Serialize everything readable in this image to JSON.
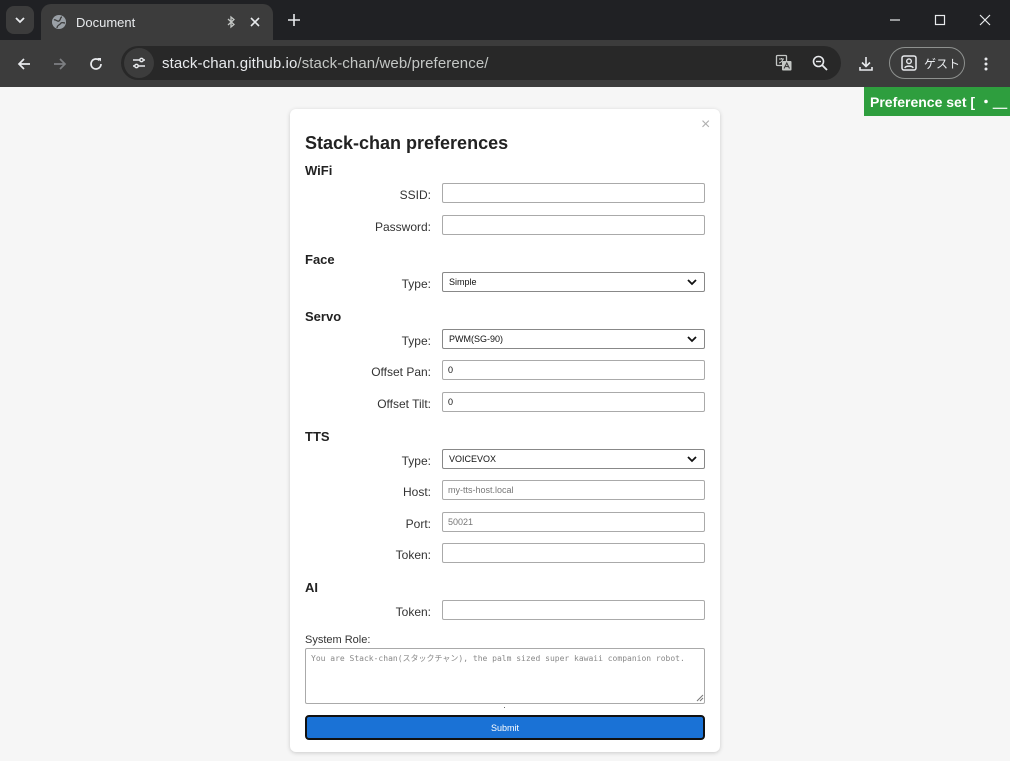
{
  "browser": {
    "tab_title": "Document",
    "url_host": "stack-chan.github.io",
    "url_path": "/stack-chan/web/preference/",
    "profile_label": "ゲスト"
  },
  "toast": {
    "text": "Preference set [ ・＿・]"
  },
  "form": {
    "title": "Stack-chan preferences",
    "wifi": {
      "heading": "WiFi",
      "ssid_label": "SSID:",
      "ssid_value": "",
      "password_label": "Password:",
      "password_value": ""
    },
    "face": {
      "heading": "Face",
      "type_label": "Type:",
      "type_value": "Simple"
    },
    "servo": {
      "heading": "Servo",
      "type_label": "Type:",
      "type_value": "PWM(SG-90)",
      "offset_pan_label": "Offset Pan:",
      "offset_pan_value": "0",
      "offset_tilt_label": "Offset Tilt:",
      "offset_tilt_value": "0"
    },
    "tts": {
      "heading": "TTS",
      "type_label": "Type:",
      "type_value": "VOICEVOX",
      "host_label": "Host:",
      "host_placeholder": "my-tts-host.local",
      "port_label": "Port:",
      "port_placeholder": "50021",
      "token_label": "Token:",
      "token_value": ""
    },
    "ai": {
      "heading": "AI",
      "token_label": "Token:",
      "token_value": ""
    },
    "system_role": {
      "label": "System Role:",
      "placeholder": "You are Stack-chan(スタックチャン), the palm sized super kawaii companion robot."
    },
    "submit_label": "Submit"
  },
  "colors": {
    "toast_bg": "#2e9e3e",
    "submit_bg": "#1a72d6",
    "chrome_bg": "#202124",
    "toolbar_bg": "#3c3c3c"
  }
}
